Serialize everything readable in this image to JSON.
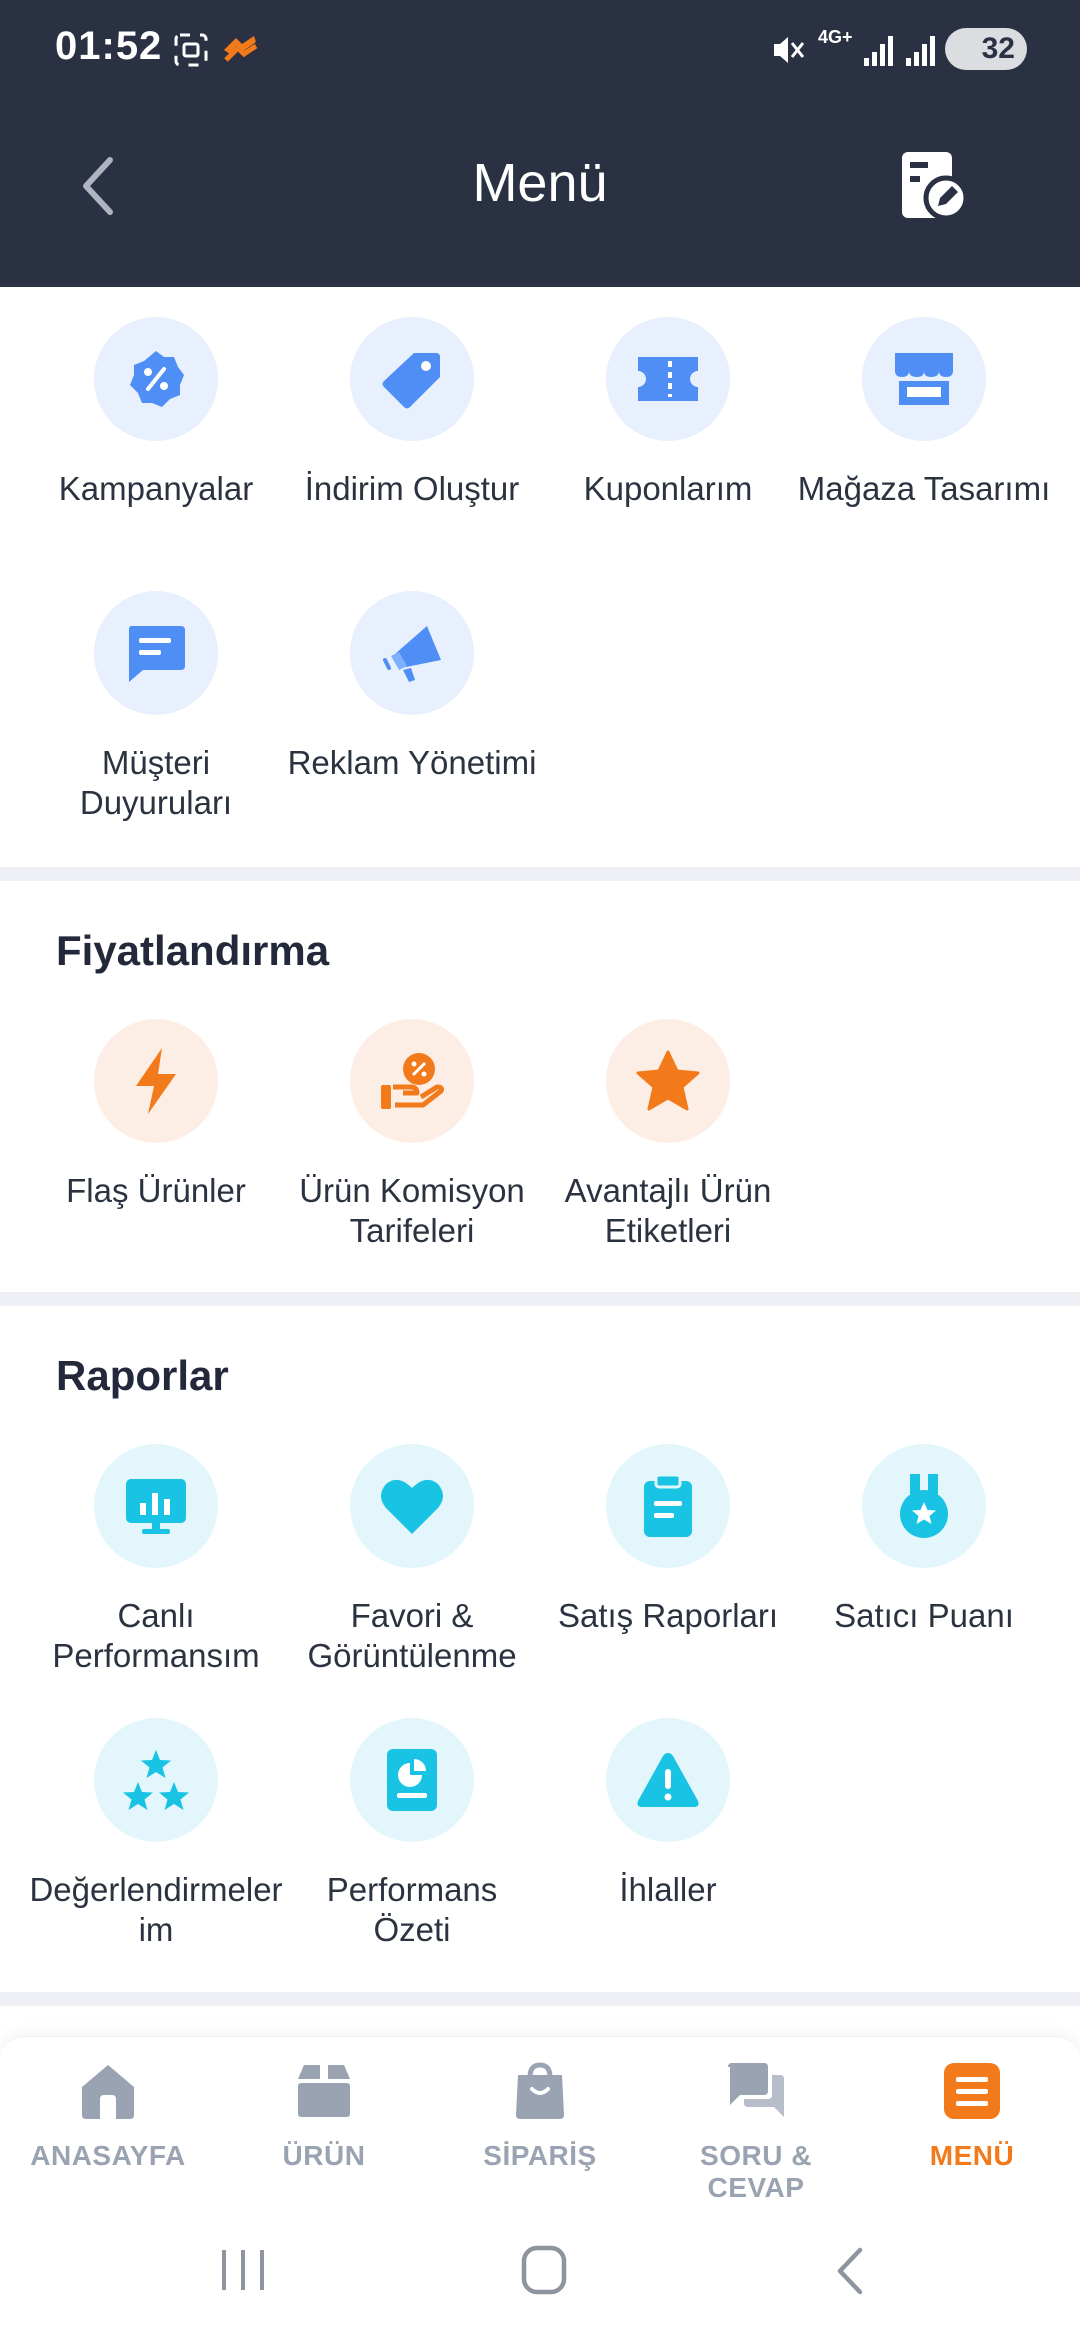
{
  "status_bar": {
    "time": "01:52",
    "network": "4G+",
    "battery": "32"
  },
  "header": {
    "title": "Menü"
  },
  "campaigns": {
    "items": [
      {
        "label": "Kampanyalar",
        "icon": "percent-badge-icon"
      },
      {
        "label": "İndirim Oluştur",
        "icon": "price-tag-icon"
      },
      {
        "label": "Kuponlarım",
        "icon": "ticket-icon"
      },
      {
        "label": "Mağaza Tasarımı",
        "icon": "storefront-icon"
      },
      {
        "label": "Müşteri Duyuruları",
        "icon": "chat-message-icon"
      },
      {
        "label": "Reklam Yönetimi",
        "icon": "megaphone-icon"
      }
    ]
  },
  "pricing": {
    "title": "Fiyatlandırma",
    "items": [
      {
        "label": "Flaş Ürünler",
        "icon": "lightning-icon"
      },
      {
        "label": "Ürün Komisyon Tarifeleri",
        "icon": "hand-coin-icon"
      },
      {
        "label": "Avantajlı Ürün Etiketleri",
        "icon": "star-icon"
      }
    ]
  },
  "reports": {
    "title": "Raporlar",
    "items": [
      {
        "label": "Canlı Performansım",
        "icon": "monitor-chart-icon"
      },
      {
        "label": "Favori & Görüntülenme",
        "icon": "heart-icon"
      },
      {
        "label": "Satış Raporları",
        "icon": "clipboard-icon"
      },
      {
        "label": "Satıcı Puanı",
        "icon": "medal-icon"
      },
      {
        "label": "Değerlendirmelerim",
        "icon": "three-stars-icon"
      },
      {
        "label": "Performans Özeti",
        "icon": "report-pie-icon"
      },
      {
        "label": "İhlaller",
        "icon": "warning-icon"
      }
    ]
  },
  "bottom_nav": [
    {
      "label": "ANASAYFA",
      "icon": "home-icon",
      "active": false
    },
    {
      "label": "ÜRÜN",
      "icon": "box-icon",
      "active": false
    },
    {
      "label": "SİPARİŞ",
      "icon": "shopping-bag-icon",
      "active": false
    },
    {
      "label": "SORU & CEVAP",
      "icon": "chat-bubbles-icon",
      "active": false
    },
    {
      "label": "MENÜ",
      "icon": "menu-icon",
      "active": true
    }
  ],
  "colors": {
    "header_bg": "#2a3142",
    "accent": "#f27a1a",
    "blue_icon": "#4f8ef5",
    "cyan_icon": "#18c3e3",
    "orange_icon": "#f27a1a",
    "inactive_nav": "#9aa3b1"
  }
}
